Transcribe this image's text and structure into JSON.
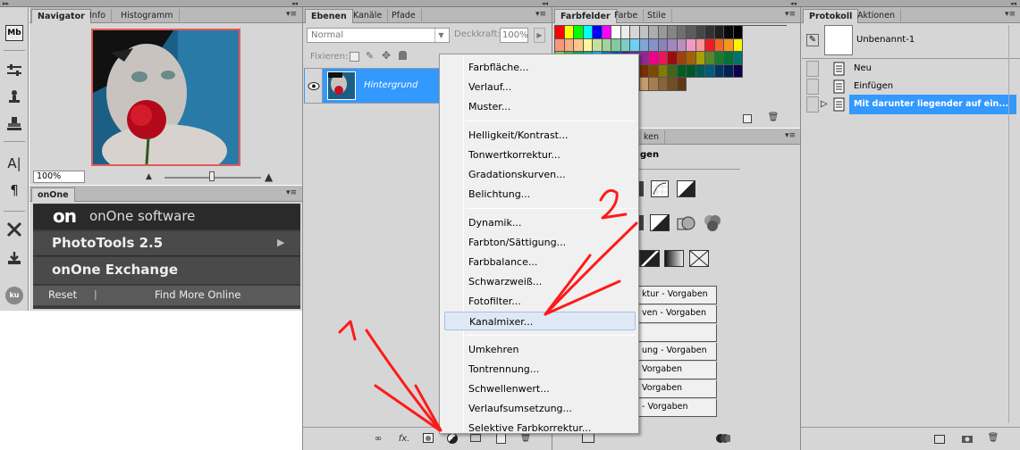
{
  "navigator": {
    "tabs": [
      "Navigator",
      "Info",
      "Histogramm"
    ],
    "zoom": "100%"
  },
  "onone": {
    "tab": "onOne",
    "logo_mark": "on",
    "logo_text": "onOne software",
    "items": [
      "PhotoTools 2.5",
      "onOne Exchange"
    ],
    "arrow": "▶",
    "footer": {
      "left": "Reset",
      "sep": "|",
      "right": "Find More Online"
    }
  },
  "tools": {
    "mb_label": "Mb",
    "ku_label": "ku",
    "text_label": "A|",
    "para_label": "¶"
  },
  "layers": {
    "tabs": [
      "Ebenen",
      "Kanäle",
      "Pfade"
    ],
    "blend_mode": "Normal",
    "opacity_label": "Deckkraft:",
    "opacity_value": "100%",
    "lock_label": "Fixieren:",
    "layer_name": "Hintergrund",
    "fx_label": "fx."
  },
  "menu": {
    "groups": [
      [
        "Farbfläche...",
        "Verlauf...",
        "Muster..."
      ],
      [
        "Helligkeit/Kontrast...",
        "Tonwertkorrektur...",
        "Gradationskurven...",
        "Belichtung..."
      ],
      [
        "Dynamik...",
        "Farbton/Sättigung...",
        "Farbbalance...",
        "Schwarzweiß...",
        "Fotofilter...",
        "Kanalmixer..."
      ],
      [
        "Umkehren",
        "Tontrennung...",
        "Schwellenwert...",
        "Verlaufsumsetzung...",
        "Selektive Farbkorrektur..."
      ]
    ],
    "highlighted": "Kanalmixer..."
  },
  "swatches": {
    "tabs": [
      "Farbfelder",
      "Farbe",
      "Stile"
    ]
  },
  "adjustments": {
    "tab_partial": "ken",
    "title_partial": "gen",
    "preset_rows": [
      "ktur - Vorgaben",
      "ven - Vorgaben",
      "",
      "ung - Vorgaben",
      "Vorgaben",
      "Vorgaben",
      "- Vorgaben"
    ]
  },
  "history": {
    "tabs": [
      "Protokoll",
      "Aktionen"
    ],
    "snapshot": "Unbenannt-1",
    "steps": [
      "Neu",
      "Einfügen",
      "Mit darunter liegender auf ein..."
    ]
  },
  "annotations": {
    "one": "1",
    "two": "2"
  },
  "colors": {
    "selection": "#3399ff",
    "panel": "#d6d6d6",
    "annotation": "#ff1a1a",
    "onone_bg": "#3a3a3a"
  }
}
